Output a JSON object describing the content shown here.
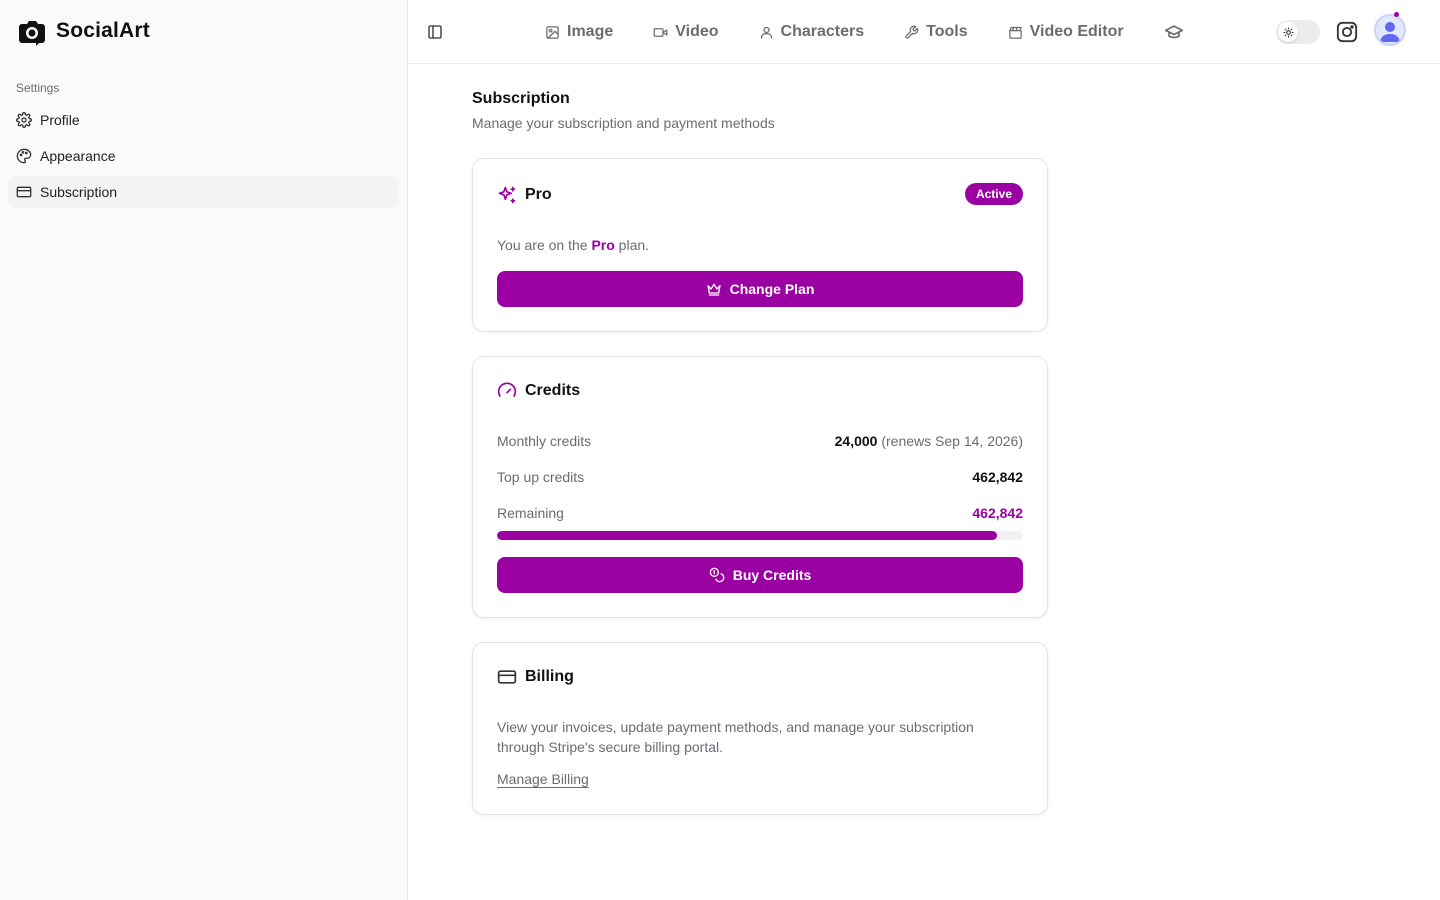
{
  "app": {
    "name": "SocialArt"
  },
  "sidebar": {
    "section_label": "Settings",
    "items": [
      {
        "label": "Profile",
        "icon": "gear-icon"
      },
      {
        "label": "Appearance",
        "icon": "palette-icon"
      },
      {
        "label": "Subscription",
        "icon": "credit-card-icon",
        "active": true
      }
    ]
  },
  "topnav": {
    "items": [
      {
        "label": "Image",
        "icon": "image-icon"
      },
      {
        "label": "Video",
        "icon": "video-icon"
      },
      {
        "label": "Characters",
        "icon": "user-icon"
      },
      {
        "label": "Tools",
        "icon": "wrench-icon"
      },
      {
        "label": "Video Editor",
        "icon": "clapperboard-icon"
      },
      {
        "label": "",
        "icon": "graduation-cap-icon"
      }
    ],
    "theme": "light"
  },
  "page": {
    "title": "Subscription",
    "subtitle": "Manage your subscription and payment methods"
  },
  "plan_card": {
    "title": "Pro",
    "badge": "Active",
    "text_before": "You are on the ",
    "plan_name": "Pro",
    "text_after": " plan.",
    "button": "Change Plan"
  },
  "credits_card": {
    "title": "Credits",
    "monthly_label": "Monthly credits",
    "monthly_value": "24,000",
    "monthly_note": "(renews Sep 14, 2026)",
    "topup_label": "Top up credits",
    "topup_value": "462,842",
    "remaining_label": "Remaining",
    "remaining_value": "462,842",
    "remaining_fraction": 0.95,
    "button": "Buy Credits"
  },
  "billing_card": {
    "title": "Billing",
    "description": "View your invoices, update payment methods, and manage your subscription through Stripe's secure billing portal.",
    "link": "Manage Billing"
  },
  "colors": {
    "accent": "#9b00a3",
    "muted_text": "#6b6b73",
    "sidebar_bg": "#fafafa"
  }
}
